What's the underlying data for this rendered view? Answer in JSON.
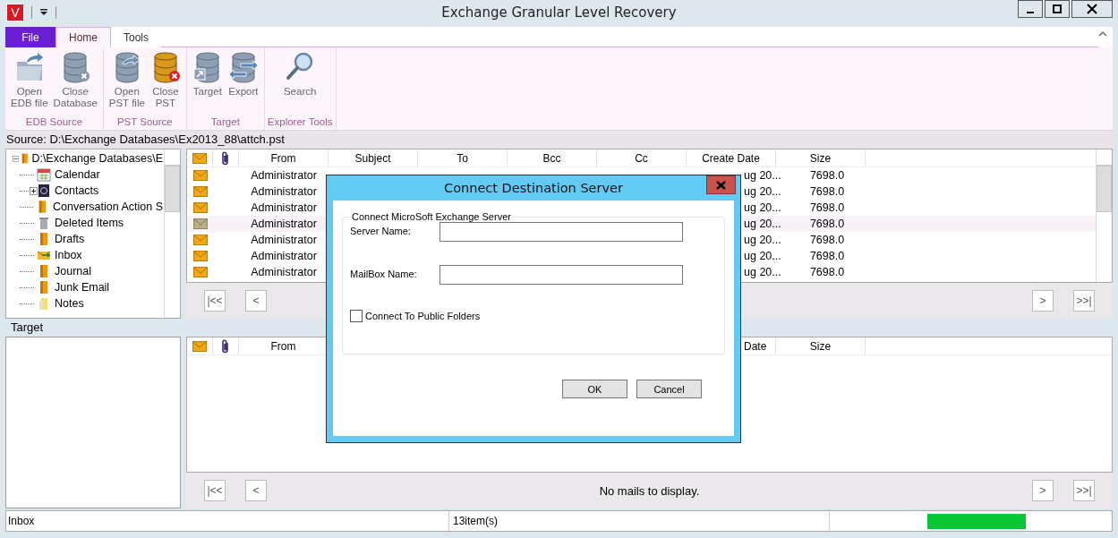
{
  "window": {
    "app_icon": "V",
    "title": "Exchange Granular Level Recovery"
  },
  "ribbon": {
    "tabs": [
      {
        "label": "File",
        "kind": "file",
        "selected": false
      },
      {
        "label": "Home",
        "kind": "tab",
        "selected": true
      },
      {
        "label": "Tools",
        "kind": "tab",
        "selected": false
      }
    ],
    "groups": [
      {
        "label": "EDB Source",
        "buttons": [
          {
            "lines": [
              "Open",
              "EDB file"
            ]
          },
          {
            "lines": [
              "Close",
              "Database"
            ]
          }
        ]
      },
      {
        "label": "PST Source",
        "buttons": [
          {
            "lines": [
              "Open",
              "PST file"
            ]
          },
          {
            "lines": [
              "Close",
              "PST"
            ]
          }
        ]
      },
      {
        "label": "Target",
        "buttons": [
          {
            "lines": [
              "Target"
            ]
          },
          {
            "lines": [
              "Export"
            ]
          }
        ]
      },
      {
        "label": "Explorer Tools",
        "buttons": [
          {
            "lines": [
              "Search"
            ]
          }
        ]
      }
    ]
  },
  "source": "Source: D:\\Exchange Databases\\Ex2013_88\\attch.pst",
  "tree": {
    "label": "D:\\Exchange Databases\\E",
    "expanded": true,
    "children": [
      {
        "label": "Calendar",
        "expandable": false
      },
      {
        "label": "Contacts",
        "expandable": true
      },
      {
        "label": "Conversation Action S",
        "expandable": false
      },
      {
        "label": "Deleted Items",
        "expandable": false
      },
      {
        "label": "Drafts",
        "expandable": false
      },
      {
        "label": "Inbox",
        "expandable": false
      },
      {
        "label": "Journal",
        "expandable": false
      },
      {
        "label": "Junk Email",
        "expandable": false
      },
      {
        "label": "Notes",
        "expandable": false
      }
    ]
  },
  "mail_list": {
    "columns": [
      "From",
      "Subject",
      "To",
      "Bcc",
      "Cc",
      "Create Date",
      "Size"
    ],
    "rows": [
      {
        "from": "Administrator",
        "create_date": "ug 20...",
        "size": "7698.0",
        "read": false,
        "selected": false
      },
      {
        "from": "Administrator",
        "create_date": "ug 20...",
        "size": "7698.0",
        "read": false,
        "selected": false
      },
      {
        "from": "Administrator",
        "create_date": "ug 20...",
        "size": "7698.0",
        "read": false,
        "selected": false
      },
      {
        "from": "Administrator",
        "create_date": "ug 20...",
        "size": "7698.0",
        "read": true,
        "selected": true
      },
      {
        "from": "Administrator",
        "create_date": "ug 20...",
        "size": "7698.0",
        "read": false,
        "selected": false
      },
      {
        "from": "Administrator",
        "create_date": "ug 20...",
        "size": "7698.0",
        "read": false,
        "selected": false
      },
      {
        "from": "Administrator",
        "create_date": "ug 20...",
        "size": "7698.0",
        "read": false,
        "selected": false
      }
    ],
    "pager": {
      "first": "|<<",
      "prev": "<",
      "next": ">",
      "last": ">>|"
    }
  },
  "target": {
    "label": "Target"
  },
  "target_list": {
    "columns": [
      "From",
      "Date",
      "Size"
    ],
    "pager": {
      "first": "|<<",
      "prev": "<",
      "message": "No mails to display.",
      "next": ">",
      "last": ">>|"
    }
  },
  "status_bar": {
    "location": "Inbox",
    "count": "13item(s)",
    "level": 1
  },
  "dialog": {
    "title": "Connect Destination Server",
    "group": "Connect MicroSoft Exchange Server",
    "fields": [
      {
        "label": "Server Name:"
      },
      {
        "label": "MailBox Name:"
      }
    ],
    "checkbox": {
      "label": "Connect To Public Folders",
      "checked": false
    },
    "buttons": [
      "OK",
      "Cancel"
    ]
  }
}
